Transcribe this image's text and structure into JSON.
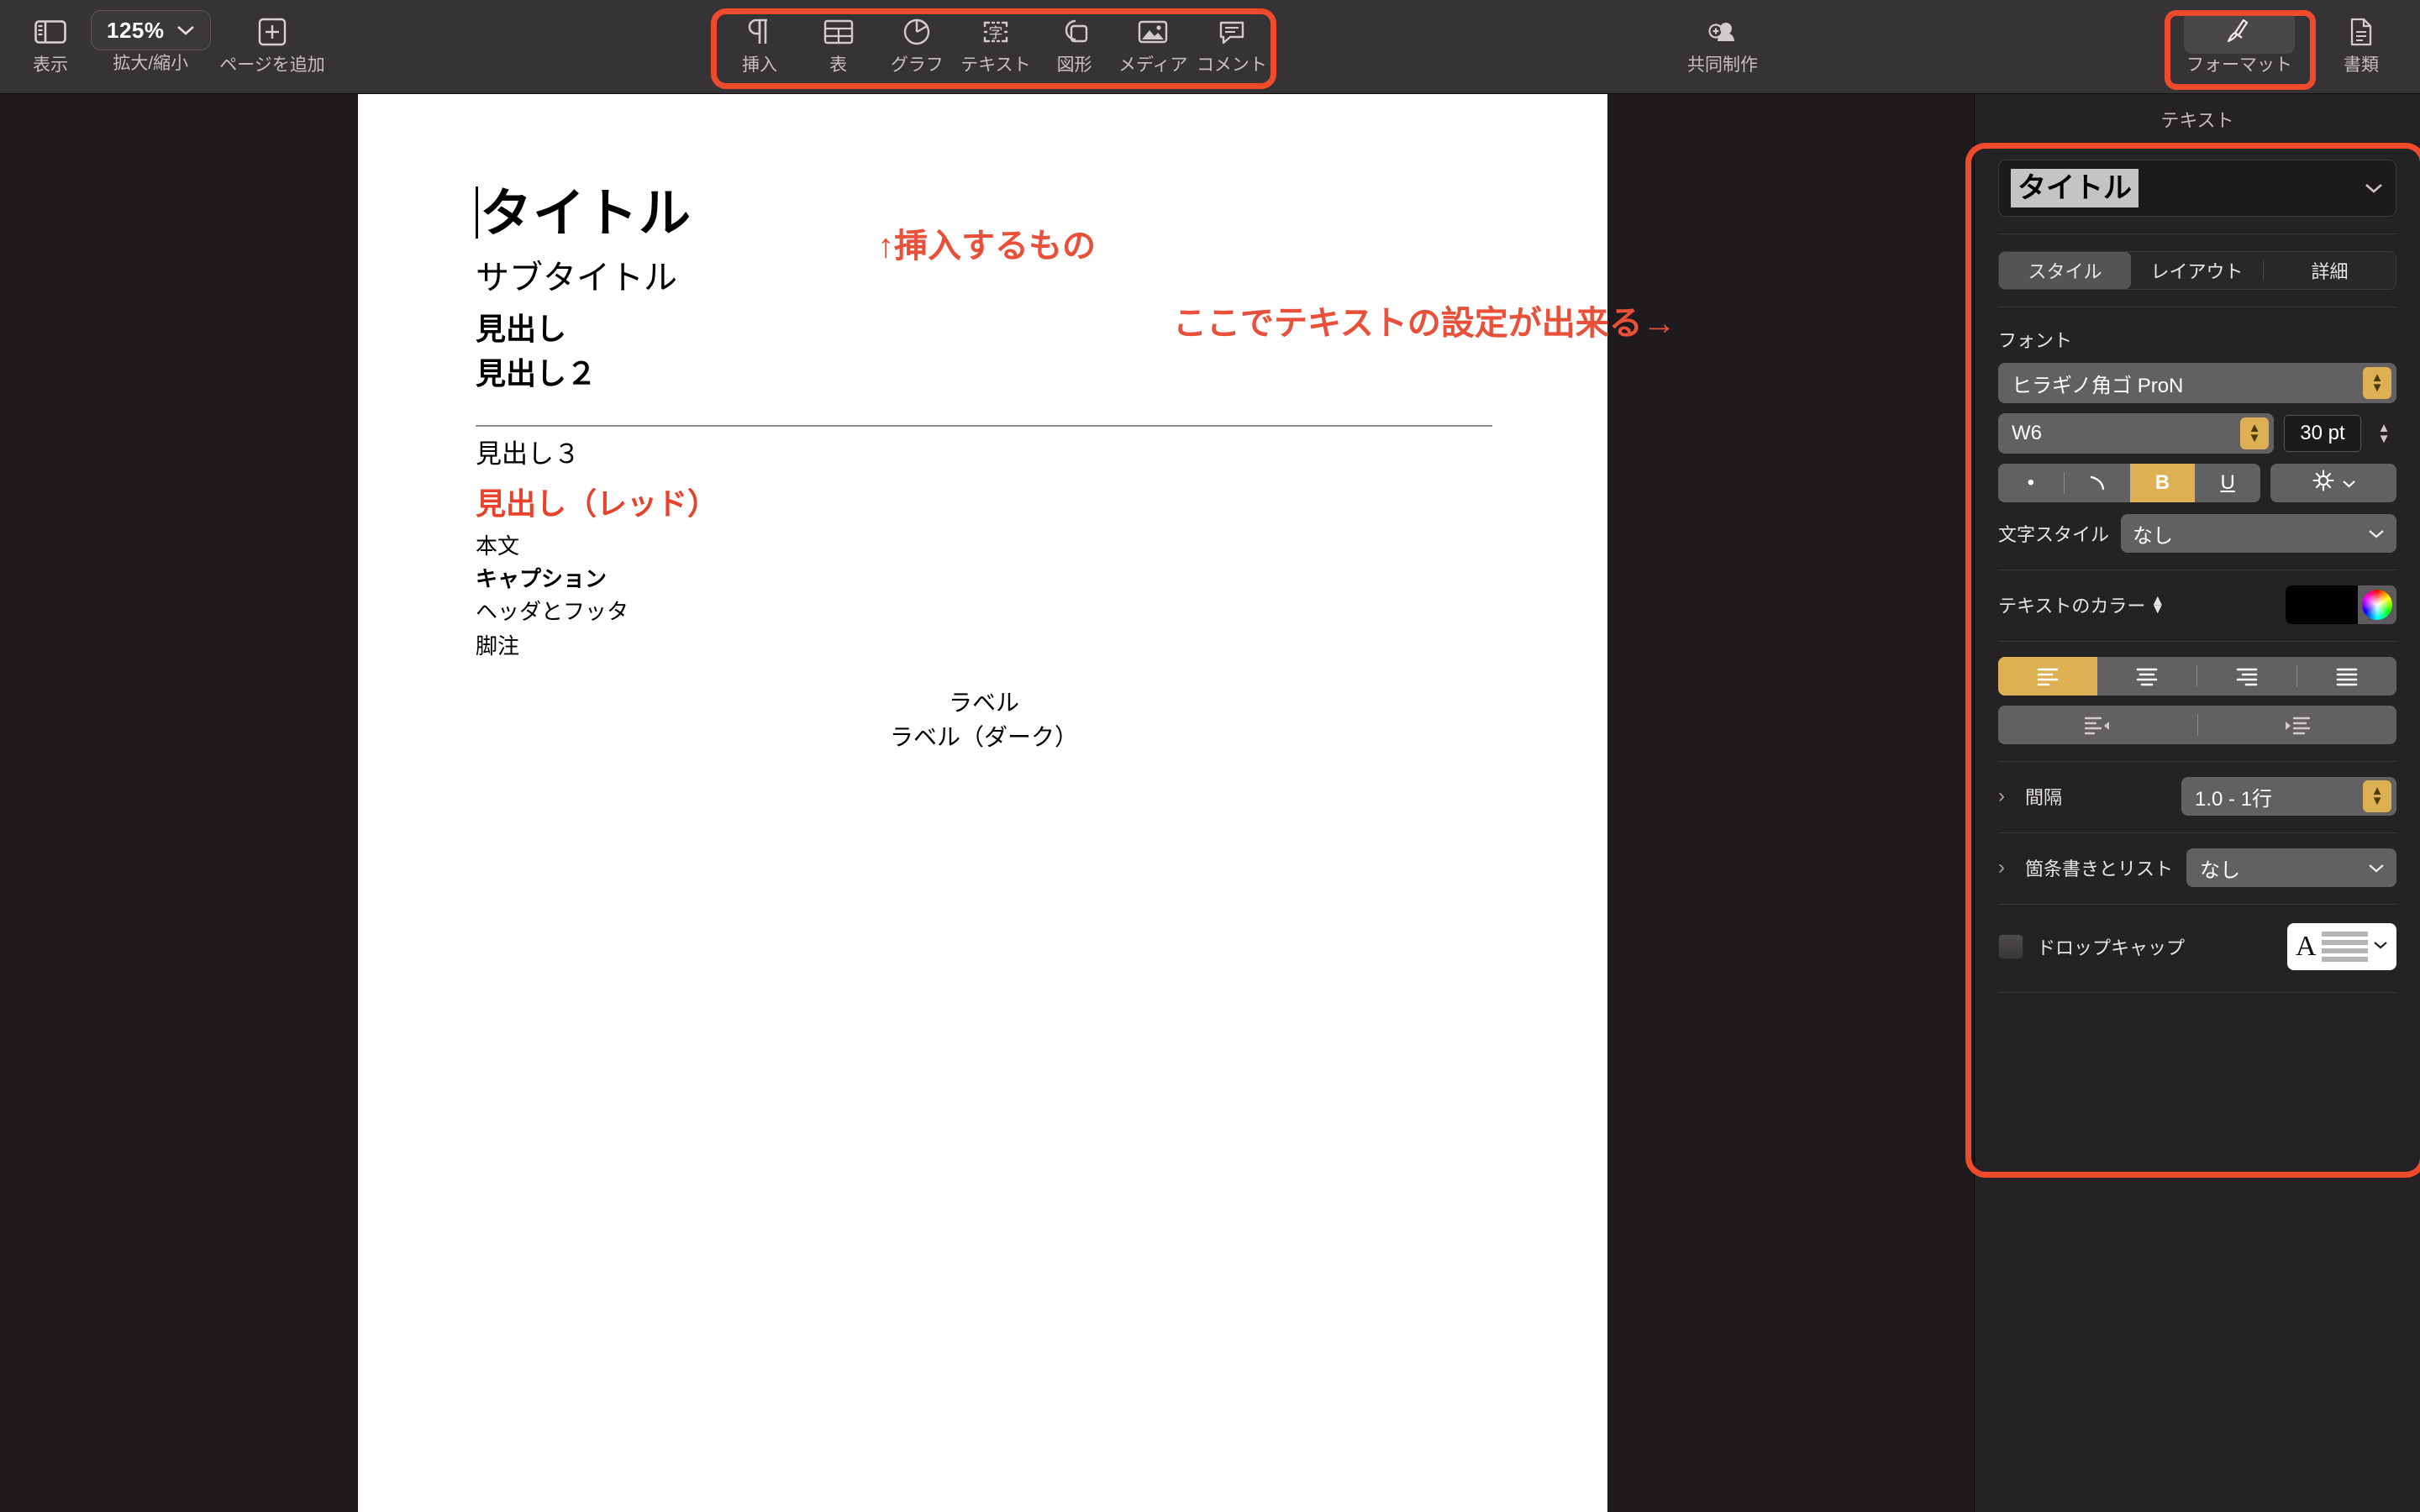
{
  "toolbar": {
    "view": {
      "label": "表示",
      "icon": "sidebar-icon"
    },
    "zoom": {
      "label": "拡大/縮小",
      "value": "125%",
      "chevron": "⌄"
    },
    "add_page": {
      "label": "ページを追加",
      "icon": "plus-square-icon"
    },
    "insert_group": [
      {
        "label": "挿入",
        "icon": "pilcrow-icon"
      },
      {
        "label": "表",
        "icon": "table-icon"
      },
      {
        "label": "グラフ",
        "icon": "chart-pie-icon"
      },
      {
        "label": "テキスト",
        "icon": "text-box-icon"
      },
      {
        "label": "図形",
        "icon": "shapes-icon"
      },
      {
        "label": "メディア",
        "icon": "media-image-icon"
      },
      {
        "label": "コメント",
        "icon": "comment-icon"
      }
    ],
    "collaborate": {
      "label": "共同制作",
      "icon": "collaborate-person-icon"
    },
    "format": {
      "label": "フォーマット",
      "icon": "format-brush-icon"
    },
    "document": {
      "label": "書類",
      "icon": "document-page-icon"
    }
  },
  "annotations": {
    "insert_note": "↑挿入するもの",
    "panel_note": "ここでテキストの設定が出来る→",
    "color": "#e8503a"
  },
  "document": {
    "title": "タイトル",
    "subtitle": "サブタイトル",
    "heading1": "見出し",
    "heading2": "見出し２",
    "heading3": "見出し３",
    "heading_red": "見出し（レッド）",
    "body": "本文",
    "caption": "キャプション",
    "header_footer": "ヘッダとフッタ",
    "footnote": "脚注",
    "label": "ラベル",
    "label_dark": "ラベル（ダーク）",
    "red_color": "#e8422c"
  },
  "panel": {
    "header": "テキスト",
    "style_name": "タイトル",
    "tabs": [
      {
        "label": "スタイル",
        "selected": true
      },
      {
        "label": "レイアウト",
        "selected": false
      },
      {
        "label": "詳細",
        "selected": false
      }
    ],
    "font_section_title": "フォント",
    "font_family": "ヒラギノ角ゴ ProN",
    "font_weight": "W6",
    "font_size": "30 pt",
    "style_buttons": {
      "bullet": "•",
      "strike": "\\",
      "bold": "B",
      "underline": "U",
      "gear": "gear-icon",
      "bold_active": true
    },
    "char_style_label": "文字スタイル",
    "char_style_value": "なし",
    "text_color_label": "テキストのカラー",
    "text_color_value": "#000000",
    "alignment": {
      "options": [
        "align-left-icon",
        "align-center-icon",
        "align-right-icon",
        "align-justify-icon"
      ],
      "selected_index": 0
    },
    "indent": {
      "options": [
        "outdent-icon",
        "indent-icon"
      ]
    },
    "spacing_label": "間隔",
    "spacing_value": "1.0 - 1行",
    "bullets_label": "箇条書きとリスト",
    "bullets_value": "なし",
    "dropcap_label": "ドロップキャップ",
    "dropcap_checked": false,
    "accent_color": "#dcb053"
  }
}
